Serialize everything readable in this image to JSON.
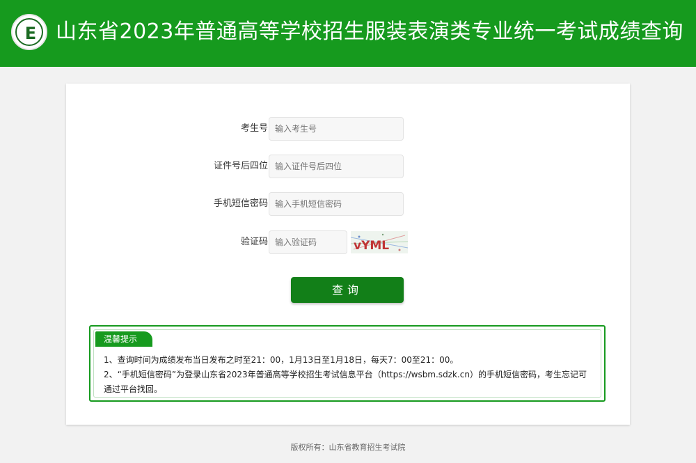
{
  "header": {
    "title": "山东省2023年普通高等学校招生服装表演类专业统一考试成绩查询",
    "logo_letter": "E",
    "bg_color": "#169a1e"
  },
  "form": {
    "exam_no": {
      "label": "考生号",
      "placeholder": "输入考生号"
    },
    "id_last4": {
      "label": "证件号后四位",
      "placeholder": "输入证件号后四位"
    },
    "sms_password": {
      "label": "手机短信密码",
      "placeholder": "输入手机短信密码"
    },
    "captcha": {
      "label": "验证码",
      "placeholder": "输入验证码",
      "image_text": "vYML"
    },
    "submit_label": "查询"
  },
  "notice": {
    "title": "温馨提示",
    "line1": "1、查询时间为成绩发布当日发布之时至21：00，1月13日至1月18日，每天7：00至21：00。",
    "line2": "2、“手机短信密码”为登录山东省2023年普通高等学校招生考试信息平台（https://wsbm.sdzk.cn）的手机短信密码，考生忘记可通过平台找回。"
  },
  "footer": {
    "copyright": "版权所有：山东省教育招生考试院"
  }
}
